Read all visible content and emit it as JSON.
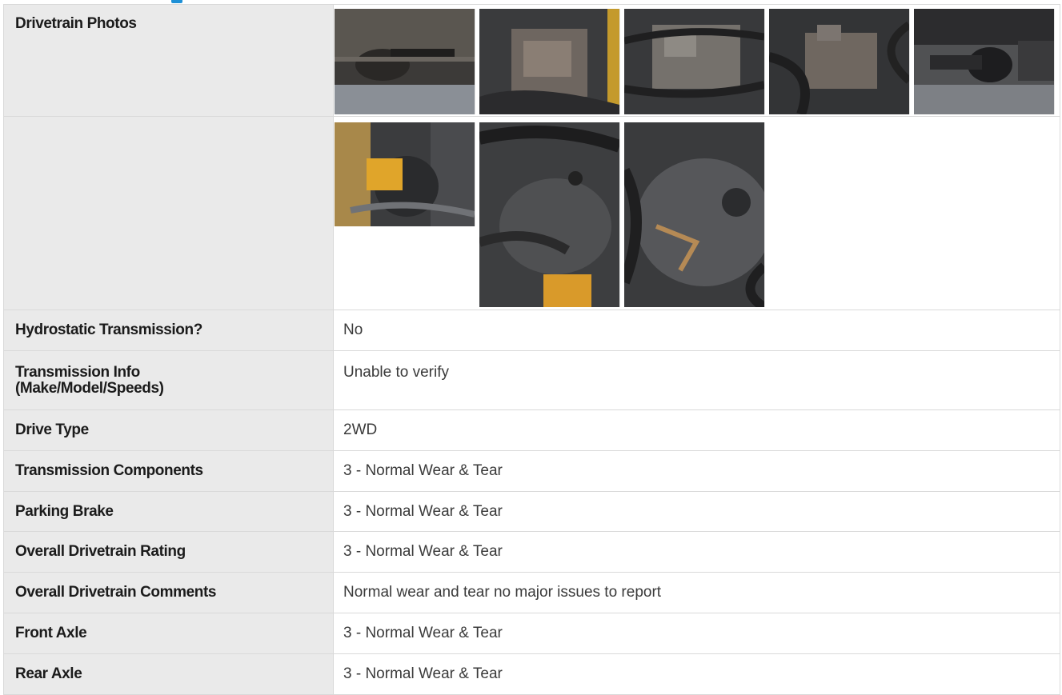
{
  "section": {
    "photos_label": "Drivetrain Photos"
  },
  "rows": [
    {
      "label": "Hydrostatic Transmission?",
      "value": "No"
    },
    {
      "label": "Transmission Info",
      "label2": "(Make/Model/Speeds)",
      "value": "Unable to verify"
    },
    {
      "label": "Drive Type",
      "value": "2WD"
    },
    {
      "label": "Transmission Components",
      "value": "3 - Normal Wear & Tear"
    },
    {
      "label": "Parking Brake",
      "value": "3 - Normal Wear & Tear"
    },
    {
      "label": "Overall Drivetrain Rating",
      "value": "3 - Normal Wear & Tear"
    },
    {
      "label": "Overall Drivetrain Comments",
      "value": "Normal wear and tear no major issues to report"
    },
    {
      "label": "Front Axle",
      "value": "3 - Normal Wear & Tear"
    },
    {
      "label": "Rear Axle",
      "value": "3 - Normal Wear & Tear"
    }
  ],
  "photos_row1": [
    "drivetrain-photo-1",
    "drivetrain-photo-2",
    "drivetrain-photo-3",
    "drivetrain-photo-4",
    "drivetrain-photo-5"
  ],
  "photos_row2": [
    "drivetrain-photo-6",
    "drivetrain-photo-7",
    "drivetrain-photo-8"
  ],
  "colors": {
    "accent": "#1e90d6",
    "label_bg": "#eaeaea",
    "border": "#d9d9d9"
  }
}
